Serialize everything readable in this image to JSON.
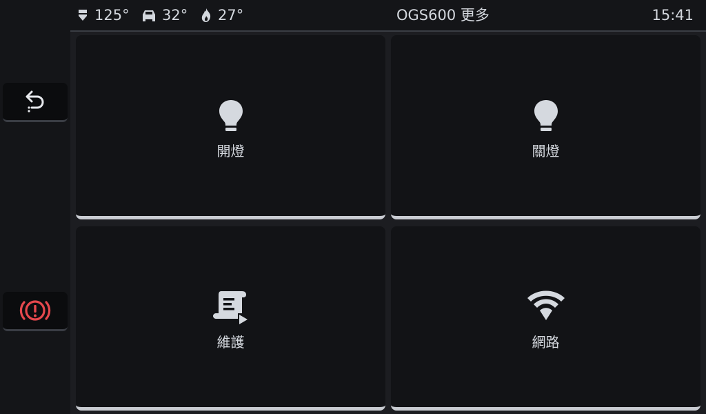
{
  "status": {
    "coolant_temp": "125°",
    "seat_temp": "32°",
    "fire_temp": "27°",
    "title": "OGS600 更多",
    "clock": "15:41"
  },
  "rail": {
    "back_icon": "back-arrow-icon",
    "alert_icon": "brake-warning-icon",
    "alert_color": "#e5484d"
  },
  "tiles": [
    {
      "label": "開燈",
      "icon": "lightbulb-icon"
    },
    {
      "label": "關燈",
      "icon": "lightbulb-icon"
    },
    {
      "label": "維護",
      "icon": "maintenance-script-icon"
    },
    {
      "label": "網路",
      "icon": "wifi-icon"
    }
  ],
  "colors": {
    "background": "#141518",
    "tile": "#121316",
    "tile_accent": "#c9ccd2",
    "text": "#d3d7dd"
  }
}
